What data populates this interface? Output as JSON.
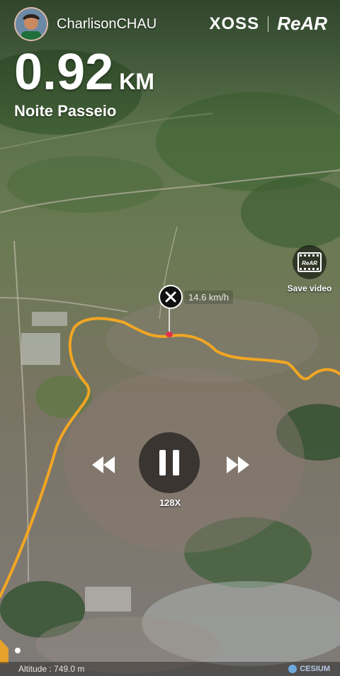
{
  "header": {
    "username": "CharlisonCHAU",
    "brand_xoss": "XOSS",
    "brand_rear": "ReAR"
  },
  "stats": {
    "distance_value": "0.92",
    "distance_unit": "KM",
    "activity_name": "Noite Passeio"
  },
  "save_video": {
    "label": "Save video",
    "icon_text": "ReAR"
  },
  "rider_marker": {
    "speed": "14.6 km/h"
  },
  "playback": {
    "speed_multiplier": "128X"
  },
  "footer": {
    "altitude": "Altitude : 749.0 m",
    "provider": "CESIUM"
  },
  "colors": {
    "route": "#f2a623",
    "marker_pin": "#e0334b"
  }
}
